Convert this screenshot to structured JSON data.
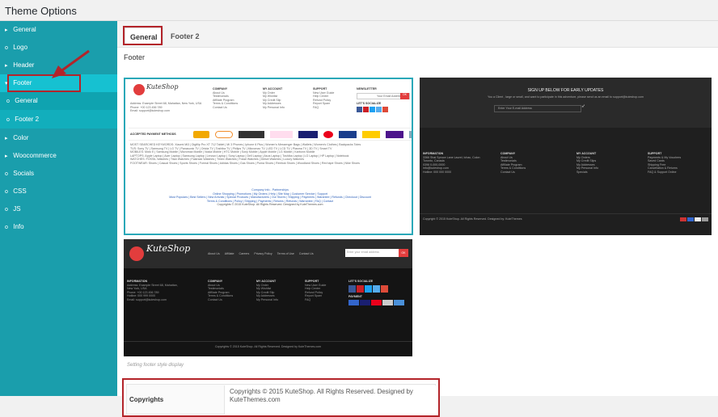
{
  "page_title": "Theme Options",
  "sidebar": {
    "items": [
      {
        "icon": "▸",
        "label": "General"
      },
      {
        "icon": "o",
        "label": "Logo"
      },
      {
        "icon": "▸",
        "label": "Header"
      },
      {
        "icon": "▾",
        "label": "Footer"
      },
      {
        "icon": "o",
        "label": "General"
      },
      {
        "icon": "o",
        "label": "Footer 2"
      },
      {
        "icon": "▸",
        "label": "Color"
      },
      {
        "icon": "▸",
        "label": "Woocommerce"
      },
      {
        "icon": "o",
        "label": "Socials"
      },
      {
        "icon": "o",
        "label": "CSS"
      },
      {
        "icon": "o",
        "label": "JS"
      },
      {
        "icon": "o",
        "label": "Info"
      }
    ]
  },
  "tabs": [
    "General",
    "Footer 2"
  ],
  "section_title": "Footer",
  "preview1": {
    "logo": "KuteShop",
    "cols": [
      "COMPANY",
      "MY ACCOUNT",
      "SUPPORT",
      "NEWSLETTER"
    ],
    "col1": [
      "About Us",
      "Testimonials",
      "Affiliate Program",
      "Terms & Conditions",
      "Contact Us"
    ],
    "col2": [
      "My Order",
      "My Wishlist",
      "My Credit Slip",
      "My Addresses",
      "My Personal Info"
    ],
    "col3": [
      "New User Guide",
      "Help Center",
      "Refund Policy",
      "Report Spam",
      "FAQ"
    ],
    "address": [
      "Address: Example Street 68, Mahattan, New York, USA",
      "Phone: +00 123 456 789",
      "Email: support@kuteshop.com"
    ],
    "newsletter_placeholder": "Your Email Address",
    "ok": "OK",
    "social_label": "LET'S SOCIALIZE",
    "payment_label": "ACCEPTED PAYMENT METHODS",
    "keywords_line": "MOST SEARCHED KEYWORDS: Xiaomi Mi3 | Digiflip Pro XT 712 Tablet | Mi 3 Phones | Iphone 6 Plus | Women's Messenger Bags | Wallets | Women's Clothes | Backpacks Totes",
    "keywords": [
      "TVS: Sony TV | Samsung TV | LG TV | Panasonic TV | Onida TV | Toshiba TV | Philips TV | Micromax TV | LED TV | LCD TV | Plasma TV | 3D TV | Smart TV",
      "MOBILES: Moto E | Samsung Mobile | Micromax Mobile | Nokia Mobile | HTC Mobile | Sony Mobile | Apple Mobile | LG Mobile | Karbonn Mobile",
      "LAPTOPS: Apple Laptop | Acer Laptop | Samsung Laptop | Lenovo Laptop | Sony Laptop | Dell Laptop | Asus Laptop | Toshiba Laptop | LG Laptop | HP Laptop | Notebook",
      "WATCHES: FOSSIL Watches | Titan Watches | Fastrack Watches | Timex Watches | Fossil Watches | Diesel Watches | Luxury Watches",
      "FOOTWEAR: Shoes | Casual Shoes | Sports Shoes | Formal Shoes | Adidas Shoes | Gas Shoes | Puma Shoes | Reebok Shoes | Woodland Shoes | Red tape Shoes | Nike Shoes"
    ],
    "bottom_links": [
      "Company Info - Partnerships",
      "Online Shopping | Promotions | My Orders | Help | Site Map | Customer Service | Support",
      "Most Populars | Best Sellers | New Arrivals | Special Products | Manufacturers | Our Stores | Shipping | Payments | Warantee | Refunds | Checkout | Discount",
      "Terms & Conditions | Policy | Shipping | Payments | Returns | Refunds | Warrantee | FAQ | Contact",
      "Copyrights © 2015 KuteShop. All Rights Reserved. Designed by KuteThemes.com"
    ]
  },
  "preview2": {
    "signup_title": "SIGN UP BELOW FOR EARLY UPDATES",
    "signup_text": "You a Client , large or small, and want to participate in this adventure, please send us an email to support@kuteshop.com",
    "email_placeholder": "Enter Your E-mail Address",
    "cols": [
      "INFORMATION",
      "COMPANY",
      "MY ACCOUNT",
      "SUPPORT"
    ],
    "info": [
      "3366 Shai Spruce Lane Laurel, Ichac, Colon Toronto, Canada",
      "0396 0-000-0000",
      "info@kuteshop.com",
      "Hotline: 000 000 0000"
    ],
    "col2": [
      "About Us",
      "Testimonials",
      "Affiliate Program",
      "Terms & Conditions",
      "Contact Us"
    ],
    "col3": [
      "My Orders",
      "My Credit Slips",
      "My Addresses",
      "My Personal Info",
      "Specials"
    ],
    "col4": [
      "Payments & My Vouchers",
      "Saved Cards",
      "Shipping Free",
      "Cancellation & Returns",
      "FAQ & Support Online"
    ],
    "copyright": "Copyright © 2015 KuteShop. All Rights Reserved. Designed by: KuteThemes"
  },
  "preview3": {
    "logo": "KuteShop",
    "nav": [
      "About Us",
      "Affiliate",
      "Careers",
      "Privacy Policy",
      "Terms of Use",
      "Contact Us"
    ],
    "email_placeholder": "Enter your email address",
    "ok": "OK",
    "cols": [
      "INFORMATION",
      "COMPANY",
      "MY ACCOUNT",
      "SUPPORT",
      "LET'S SOCIALIZE"
    ],
    "info": [
      "Address: Example Street 68, Mahattan, New York, USA",
      "Phone: +00 123 456 789",
      "Hotline: 000 999 0000",
      "Email: support@kuteshop.com"
    ],
    "col2": [
      "About Us",
      "Testimonials",
      "Affiliate Program",
      "Terms & Conditions",
      "Contact Us"
    ],
    "col3": [
      "My Order",
      "My Wishlist",
      "My Credit Slip",
      "My Addresses",
      "My Personal Info"
    ],
    "col4": [
      "New User Guide",
      "Help Center",
      "Refund Policy",
      "Report Spam",
      "FAQ"
    ],
    "payment_label": "PAYMENT",
    "copyright": "Copyrights © 2015 KuteShop. All Rights Reserved. Designed by KuteThemes.com"
  },
  "hint": "Setting footer style display",
  "copyrights_field": {
    "label": "Copyrights",
    "value": "Copyrights © 2015 KuteShop. All Rights Reserved. Designed by KuteThemes.com"
  },
  "colors": {
    "sidebar": "#1a9eac",
    "sidebar_active": "#16c1d1",
    "highlight": "#b3242a",
    "brand_red": "#e23d3d"
  }
}
